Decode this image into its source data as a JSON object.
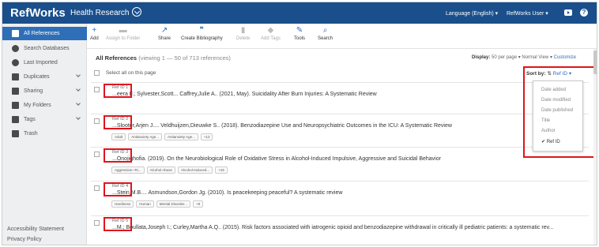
{
  "topbar": {
    "brand": "RefWorks",
    "project": "Health Research",
    "language": "Language (English) ▾",
    "user": "RefWorks User ▾"
  },
  "sidebar": {
    "items": [
      {
        "label": "All References",
        "icon": "document-icon",
        "active": true
      },
      {
        "label": "Search Databases",
        "icon": "database-icon"
      },
      {
        "label": "Last Imported",
        "icon": "clock-icon"
      },
      {
        "label": "Duplicates",
        "icon": "duplicates-icon"
      },
      {
        "label": "Sharing",
        "icon": "people-icon"
      },
      {
        "label": "My Folders",
        "icon": "folder-icon"
      },
      {
        "label": "Tags",
        "icon": "tag-icon"
      },
      {
        "label": "Trash",
        "icon": "trash-icon"
      }
    ],
    "footer": [
      "Accessibility Statement",
      "Privacy Policy"
    ]
  },
  "toolbar": {
    "add": "Add",
    "assign": "Assign to Folder",
    "share": "Share",
    "bib": "Create Bibliography",
    "delete": "Delete",
    "addtags": "Add Tags",
    "tools": "Tools",
    "search": "Search"
  },
  "list": {
    "title": "All References",
    "subtitle": "(viewing 1 — 50 of 713 references)",
    "display_label": "Display:",
    "display_value": "50 per page ▾  Normal View ▾",
    "customize": "Customize",
    "select_all": "Select all on this page",
    "sort_label": "Sort by:",
    "sort_value": "Ref ID ▾"
  },
  "sort_options": [
    "Date added",
    "Date modified",
    "Date published",
    "Title",
    "Author",
    "✔ Ref ID"
  ],
  "refs": [
    {
      "id": "Ref ID 1",
      "cite": "...eera F.; Sylvester,Scott... Caffrey,Julie A.. (2021, May). Suicidality After Burn Injuries: A Systematic Review",
      "tags": []
    },
    {
      "id": "Ref ID 2",
      "cite": "...Slooter,Arjen J.... Veldhuijzen,Dieuwke S.. (2018). Benzodiazepine Use and Neuropsychiatric Outcomes in the ICU: A Systematic Review",
      "tags": [
        "Adult",
        "Antianxiety Age...",
        "Antianxiety Age...",
        "+12"
      ]
    },
    {
      "id": "Ref ID 3",
      "cite": "...Onojighofia. (2019). On the Neurobiological Role of Oxidative Stress in Alcohol-Induced Impulsive, Aggressive and Suicidal Behavior",
      "tags": [
        "Aggression--Ri...",
        "Alcohol Abuse",
        "Alcohol-Induced...",
        "+19"
      ]
    },
    {
      "id": "Ref ID 4",
      "cite": "...Stein,M.B.... Asmundson,Gordon Jg. (2010). Is peacekeeping peaceful? A systematic review",
      "tags": [
        "Hardiness",
        "Human",
        "Mental Disorder...",
        "+9"
      ]
    },
    {
      "id": "Ref ID 5",
      "cite": "...M.; Boullata,Joseph I.; Curley,Martha A.Q.. (2015). Risk factors associated with iatrogenic opioid and benzodiazepine withdrawal in critically ill pediatric patients: a systematic rev...",
      "tags": []
    }
  ]
}
